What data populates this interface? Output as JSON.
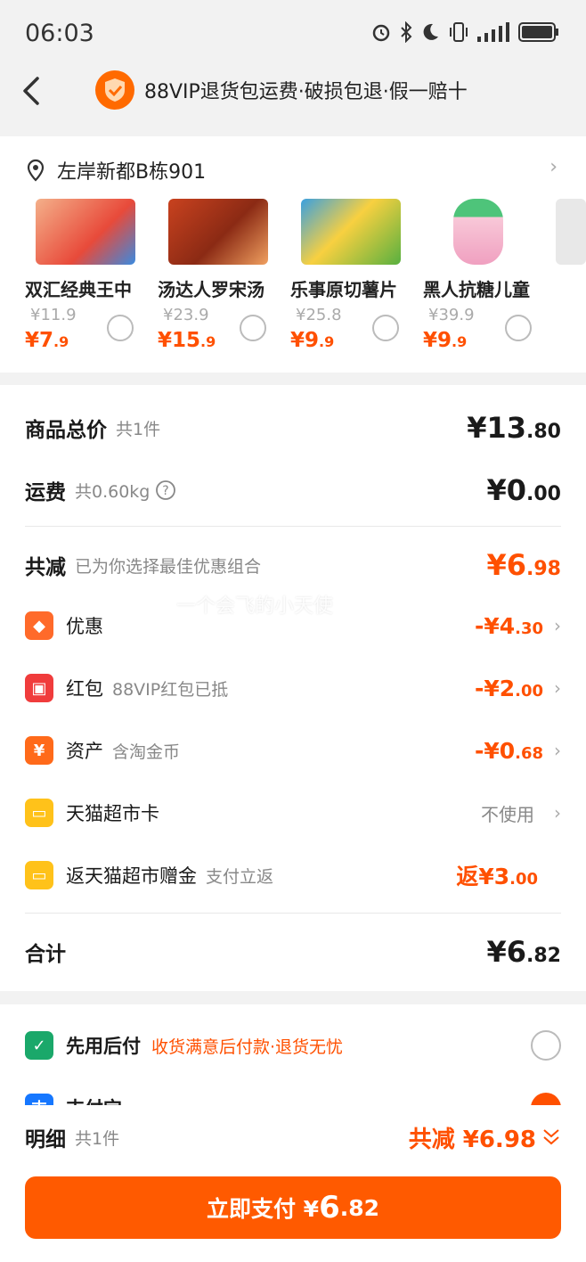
{
  "status": {
    "time": "06:03"
  },
  "header": {
    "banner": "88VIP退货包运费·破损包退·假一赔十"
  },
  "address": {
    "text": "左岸新都B栋901"
  },
  "products": [
    {
      "name": "双汇经典王中",
      "orig": "¥11.9",
      "price_int": "¥7",
      "price_dec": ".9"
    },
    {
      "name": "汤达人罗宋汤",
      "orig": "¥23.9",
      "price_int": "¥15",
      "price_dec": ".9"
    },
    {
      "name": "乐事原切薯片",
      "orig": "¥25.8",
      "price_int": "¥9",
      "price_dec": ".9"
    },
    {
      "name": "黑人抗糖儿童",
      "orig": "¥39.9",
      "price_int": "¥9",
      "price_dec": ".9"
    }
  ],
  "summary": {
    "goods_label": "商品总价",
    "goods_count": "共1件",
    "goods_int": "¥13",
    "goods_dec": ".80",
    "ship_label": "运费",
    "ship_weight": "共0.60kg",
    "ship_int": "¥0",
    "ship_dec": ".00",
    "discount_label": "共减",
    "discount_note": "已为你选择最佳优惠组合",
    "discount_int": "¥6",
    "discount_dec": ".98",
    "watermark": "一个会飞的小天使",
    "items": [
      {
        "label": "优惠",
        "note": "",
        "amt_int": "-¥4",
        "amt_dec": ".30"
      },
      {
        "label": "红包",
        "note": "88VIP红包已抵",
        "amt_int": "-¥2",
        "amt_dec": ".00"
      },
      {
        "label": "资产",
        "note": "含淘金币",
        "amt_int": "-¥0",
        "amt_dec": ".68"
      },
      {
        "label": "天猫超市卡",
        "note": "",
        "value": "不使用"
      },
      {
        "label": "返天猫超市赠金",
        "note": "支付立返",
        "amt_int": "返¥3",
        "amt_dec": ".00"
      }
    ],
    "total_label": "合计",
    "total_int": "¥6",
    "total_dec": ".82"
  },
  "payment": {
    "paylater_label": "先用后付",
    "paylater_note": "收货满意后付款·退货无忧",
    "alipay_label": "支付宝"
  },
  "bottom": {
    "detail_label": "明细",
    "detail_count": "共1件",
    "reduce_text": "共减 ¥6.98",
    "pay_prefix": "立即支付 ¥",
    "pay_int": "6",
    "pay_dec": ".82"
  },
  "colors": {
    "accent": "#ff5000",
    "button": "#ff5a00"
  }
}
